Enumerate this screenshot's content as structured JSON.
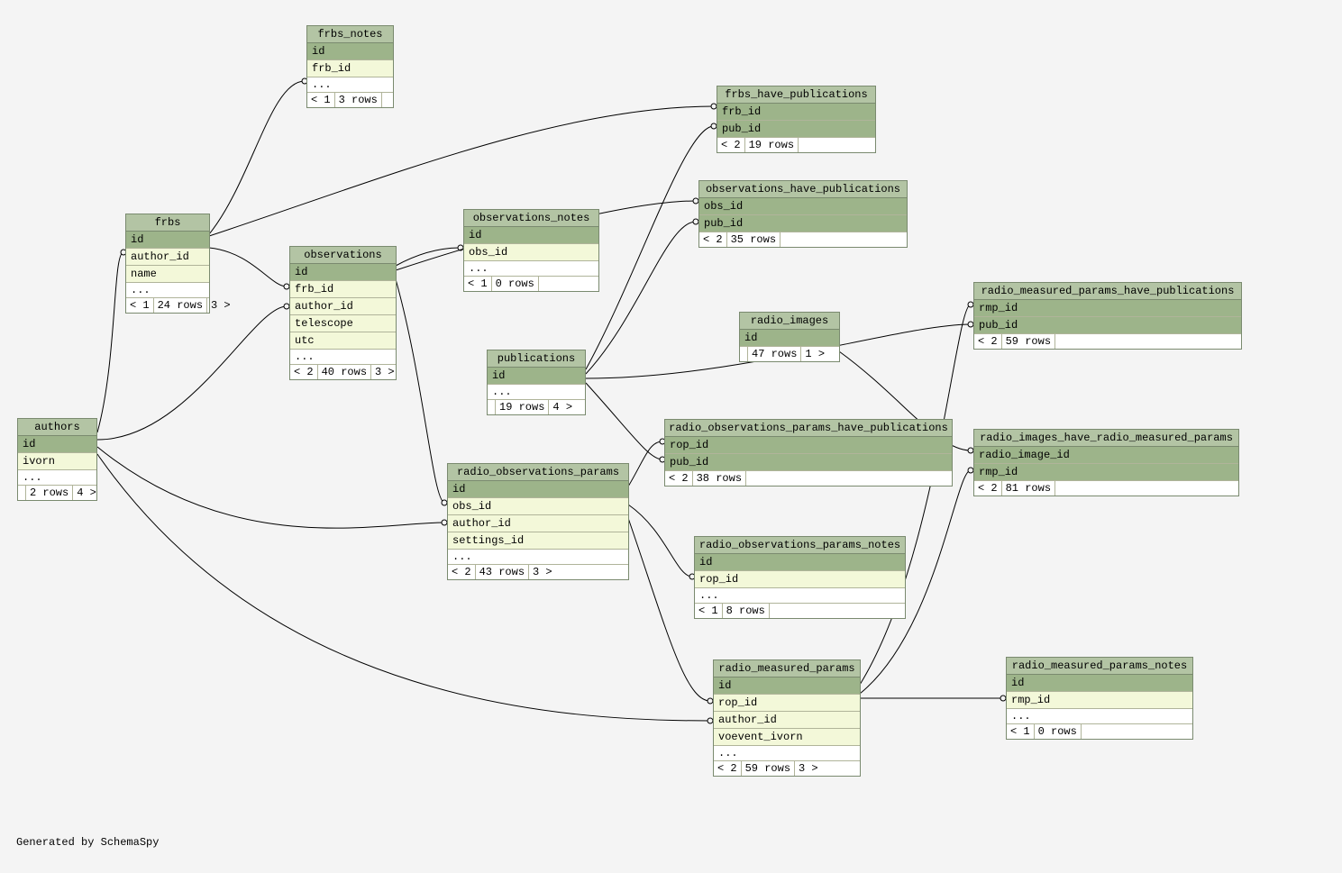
{
  "global": {
    "footer_text": "Generated by SchemaSpy",
    "ellipsis": "..."
  },
  "tables": {
    "frbs_notes": {
      "title": "frbs_notes",
      "cols": {
        "id": "id",
        "frb_id": "frb_id"
      },
      "footer": {
        "left": "< 1",
        "rows": "3 rows"
      }
    },
    "frbs": {
      "title": "frbs",
      "cols": {
        "id": "id",
        "author_id": "author_id",
        "name": "name"
      },
      "footer": {
        "left": "< 1",
        "rows": "24 rows",
        "right": "3 >"
      }
    },
    "observations": {
      "title": "observations",
      "cols": {
        "id": "id",
        "frb_id": "frb_id",
        "author_id": "author_id",
        "telescope": "telescope",
        "utc": "utc"
      },
      "footer": {
        "left": "< 2",
        "rows": "40 rows",
        "right": "3 >"
      }
    },
    "observations_notes": {
      "title": "observations_notes",
      "cols": {
        "id": "id",
        "obs_id": "obs_id"
      },
      "footer": {
        "left": "< 1",
        "rows": "0 rows"
      }
    },
    "publications": {
      "title": "publications",
      "cols": {
        "id": "id"
      },
      "footer": {
        "rows": "19 rows",
        "right": "4 >"
      }
    },
    "authors": {
      "title": "authors",
      "cols": {
        "id": "id",
        "ivorn": "ivorn"
      },
      "footer": {
        "rows": "2 rows",
        "right": "4 >"
      }
    },
    "frbs_have_publications": {
      "title": "frbs_have_publications",
      "cols": {
        "frb_id": "frb_id",
        "pub_id": "pub_id"
      },
      "footer": {
        "left": "< 2",
        "rows": "19 rows"
      }
    },
    "observations_have_publications": {
      "title": "observations_have_publications",
      "cols": {
        "obs_id": "obs_id",
        "pub_id": "pub_id"
      },
      "footer": {
        "left": "< 2",
        "rows": "35 rows"
      }
    },
    "radio_images": {
      "title": "radio_images",
      "cols": {
        "id": "id"
      },
      "footer": {
        "rows": "47 rows",
        "right": "1 >"
      }
    },
    "radio_measured_params_have_publications": {
      "title": "radio_measured_params_have_publications",
      "cols": {
        "rmp_id": "rmp_id",
        "pub_id": "pub_id"
      },
      "footer": {
        "left": "< 2",
        "rows": "59 rows"
      }
    },
    "radio_observations_params_have_publications": {
      "title": "radio_observations_params_have_publications",
      "cols": {
        "rop_id": "rop_id",
        "pub_id": "pub_id"
      },
      "footer": {
        "left": "< 2",
        "rows": "38 rows"
      }
    },
    "radio_images_have_radio_measured_params": {
      "title": "radio_images_have_radio_measured_params",
      "cols": {
        "radio_image_id": "radio_image_id",
        "rmp_id": "rmp_id"
      },
      "footer": {
        "left": "< 2",
        "rows": "81 rows"
      }
    },
    "radio_observations_params": {
      "title": "radio_observations_params",
      "cols": {
        "id": "id",
        "obs_id": "obs_id",
        "author_id": "author_id",
        "settings_id": "settings_id"
      },
      "footer": {
        "left": "< 2",
        "rows": "43 rows",
        "right": "3 >"
      }
    },
    "radio_observations_params_notes": {
      "title": "radio_observations_params_notes",
      "cols": {
        "id": "id",
        "rop_id": "rop_id"
      },
      "footer": {
        "left": "< 1",
        "rows": "8 rows"
      }
    },
    "radio_measured_params": {
      "title": "radio_measured_params",
      "cols": {
        "id": "id",
        "rop_id": "rop_id",
        "author_id": "author_id",
        "voevent_ivorn": "voevent_ivorn"
      },
      "footer": {
        "left": "< 2",
        "rows": "59 rows",
        "right": "3 >"
      }
    },
    "radio_measured_params_notes": {
      "title": "radio_measured_params_notes",
      "cols": {
        "id": "id",
        "rmp_id": "rmp_id"
      },
      "footer": {
        "left": "< 1",
        "rows": "0 rows"
      }
    }
  }
}
